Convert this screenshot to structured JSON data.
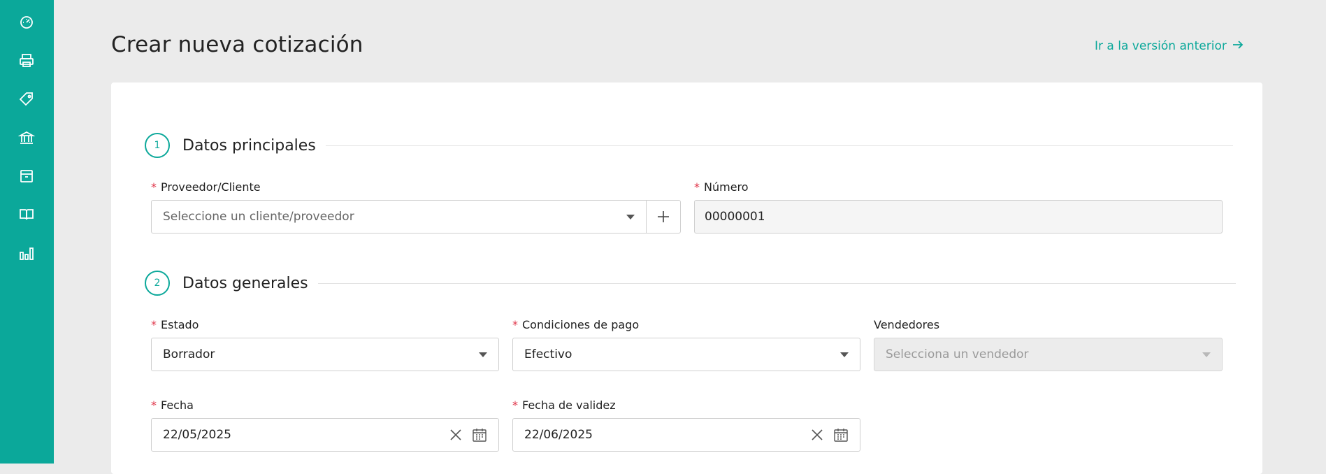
{
  "sidebar": {
    "items": [
      {
        "icon": "dashboard-gauge-icon"
      },
      {
        "icon": "printer-icon"
      },
      {
        "icon": "tag-icon"
      },
      {
        "icon": "bank-icon"
      },
      {
        "icon": "inventory-box-icon"
      },
      {
        "icon": "book-icon"
      },
      {
        "icon": "reports-chart-icon"
      }
    ],
    "background": "#0ba89a"
  },
  "header": {
    "title": "Crear nueva cotización",
    "previous_version_link": "Ir a la versión anterior"
  },
  "section1": {
    "step": "1",
    "title": "Datos principales",
    "provider": {
      "label": "Proveedor/Cliente",
      "placeholder": "Seleccione un cliente/proveedor"
    },
    "number": {
      "label": "Número",
      "value": "00000001"
    }
  },
  "section2": {
    "step": "2",
    "title": "Datos generales",
    "status": {
      "label": "Estado",
      "value": "Borrador"
    },
    "payment": {
      "label": "Condiciones de pago",
      "value": "Efectivo"
    },
    "sellers": {
      "label": "Vendedores",
      "placeholder": "Selecciona un vendedor"
    },
    "date": {
      "label": "Fecha",
      "value": "22/05/2025"
    },
    "valid_date": {
      "label": "Fecha de validez",
      "value": "22/06/2025"
    }
  },
  "required_mark": "*",
  "colors": {
    "accent": "#0ba89a",
    "required": "#e0364a"
  }
}
